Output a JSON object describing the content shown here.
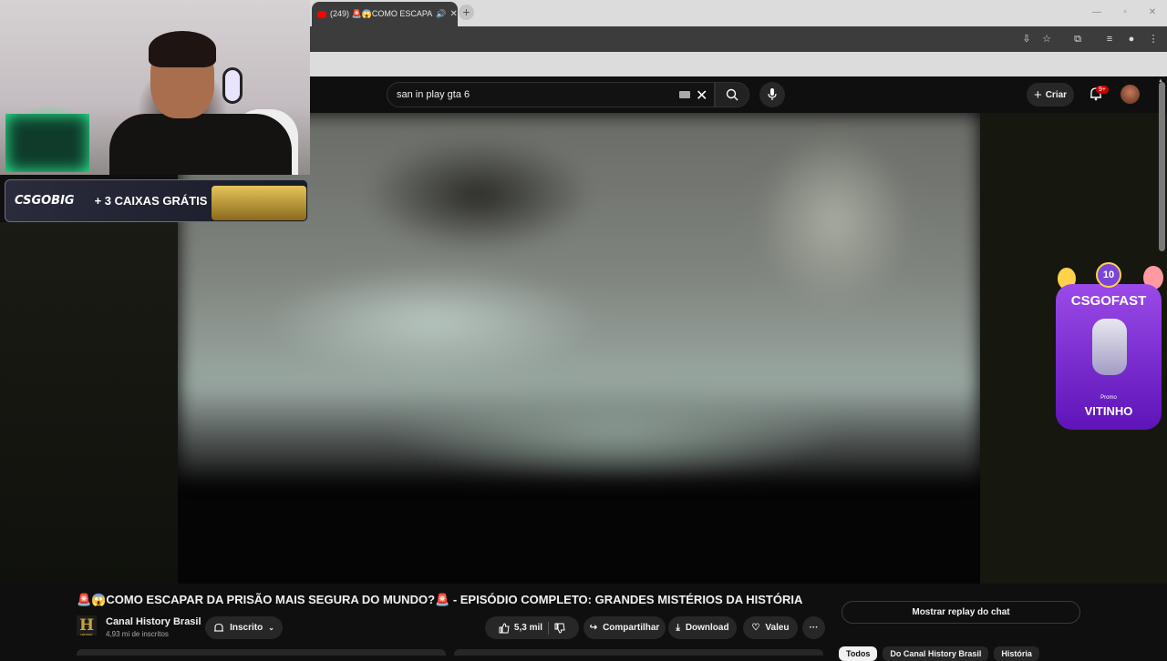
{
  "browser": {
    "tab_title": "(249) 🚨😱COMO ESCAPA",
    "tab_audio_icon": "speaker-icon",
    "new_tab_label": "+",
    "window_controls": [
      "—",
      "▫",
      "✕"
    ]
  },
  "youtube": {
    "search": {
      "value": "san in play gta 6"
    },
    "create_label": "Criar",
    "notifications_badge": "9+"
  },
  "overlays": {
    "csgobig": {
      "logo": "CSGOBIG",
      "offer": "+ 3 CAIXAS GRÁTIS"
    },
    "csgofast": {
      "badge": "10",
      "title": "CSGOFAST",
      "promo_label": "Promo",
      "code": "VITINHO"
    }
  },
  "video": {
    "title": "🚨😱COMO ESCAPAR DA PRISÃO MAIS SEGURA DO MUNDO?🚨 - EPISÓDIO COMPLETO: GRANDES MISTÉRIOS DA HISTÓRIA",
    "channel": {
      "logo_letter": "H",
      "logo_subtext": "HISTORY",
      "name": "Canal History Brasil",
      "subscribers": "4,93 mi de inscritos"
    },
    "subscribe_label": "Inscrito",
    "likes": "5,3 mil",
    "share_label": "Compartilhar",
    "download_label": "Download",
    "thanks_label": "Valeu",
    "more_label": "···"
  },
  "chat": {
    "replay_label": "Mostrar replay do chat"
  },
  "chips": [
    "Todos",
    "Do Canal History Brasil",
    "História"
  ],
  "colors": {
    "background": "#0f0f0f",
    "accent": "#ff0000",
    "pill": "#272727",
    "csgofast": "#9a4ae8"
  }
}
